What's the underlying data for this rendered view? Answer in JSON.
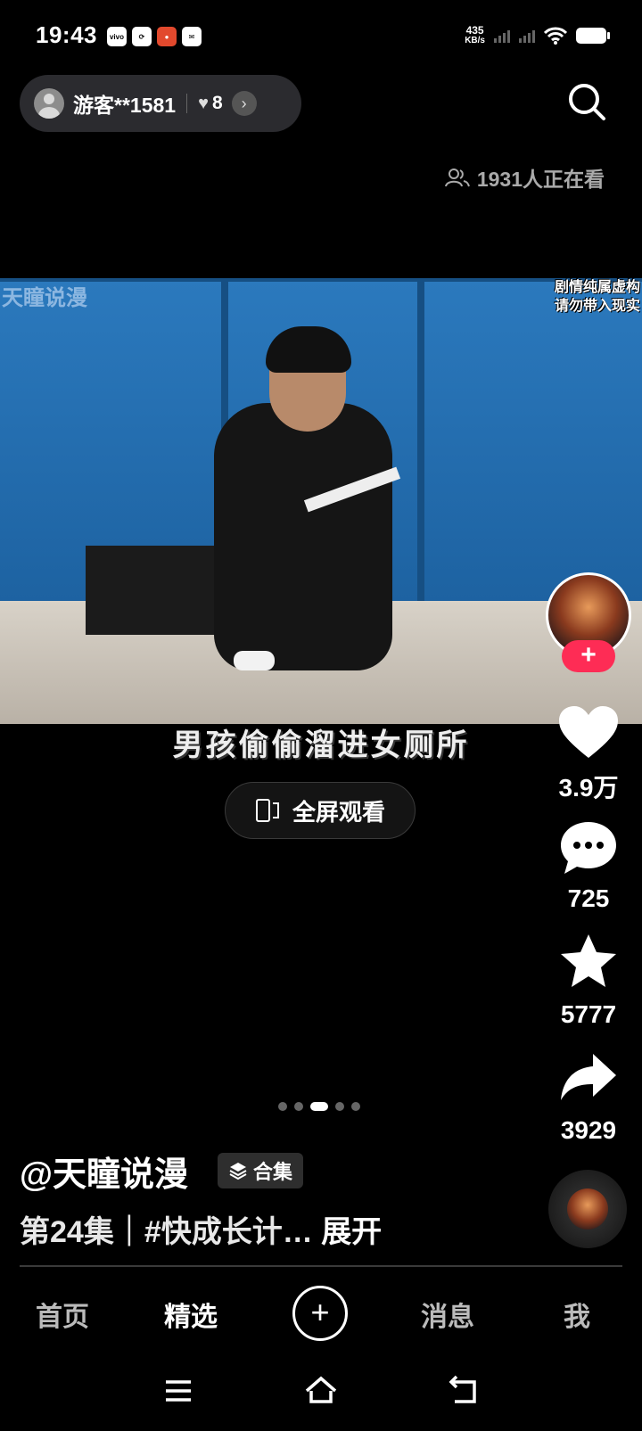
{
  "status_bar": {
    "time": "19:43",
    "app_icons": [
      "vivo",
      "ai",
      "ok",
      "msg"
    ],
    "net_speed_value": "435",
    "net_speed_unit": "KB/s"
  },
  "user_pill": {
    "username": "游客**1581",
    "likes": "8"
  },
  "viewers": {
    "text": "1931人正在看"
  },
  "video": {
    "watermark_left": "天瞳说漫",
    "watermark_right_line1": "剧情纯属虚构",
    "watermark_right_line2": "请勿带入现实",
    "subtitle": "男孩偷偷溜进女厕所"
  },
  "fullscreen": {
    "label": "全屏观看"
  },
  "rail": {
    "likes": "3.9万",
    "comments": "725",
    "favorites": "5777",
    "shares": "3929"
  },
  "pager": {
    "count": 5,
    "active_index": 2
  },
  "info": {
    "author": "@天瞳说漫",
    "collection_label": "合集",
    "description": "第24集｜#快成长计…",
    "expand": "展开"
  },
  "tabbar": {
    "home": "首页",
    "featured": "精选",
    "plus": "+",
    "messages": "消息",
    "me": "我"
  },
  "colors": {
    "accent": "#fe2c55",
    "background": "#000000"
  }
}
